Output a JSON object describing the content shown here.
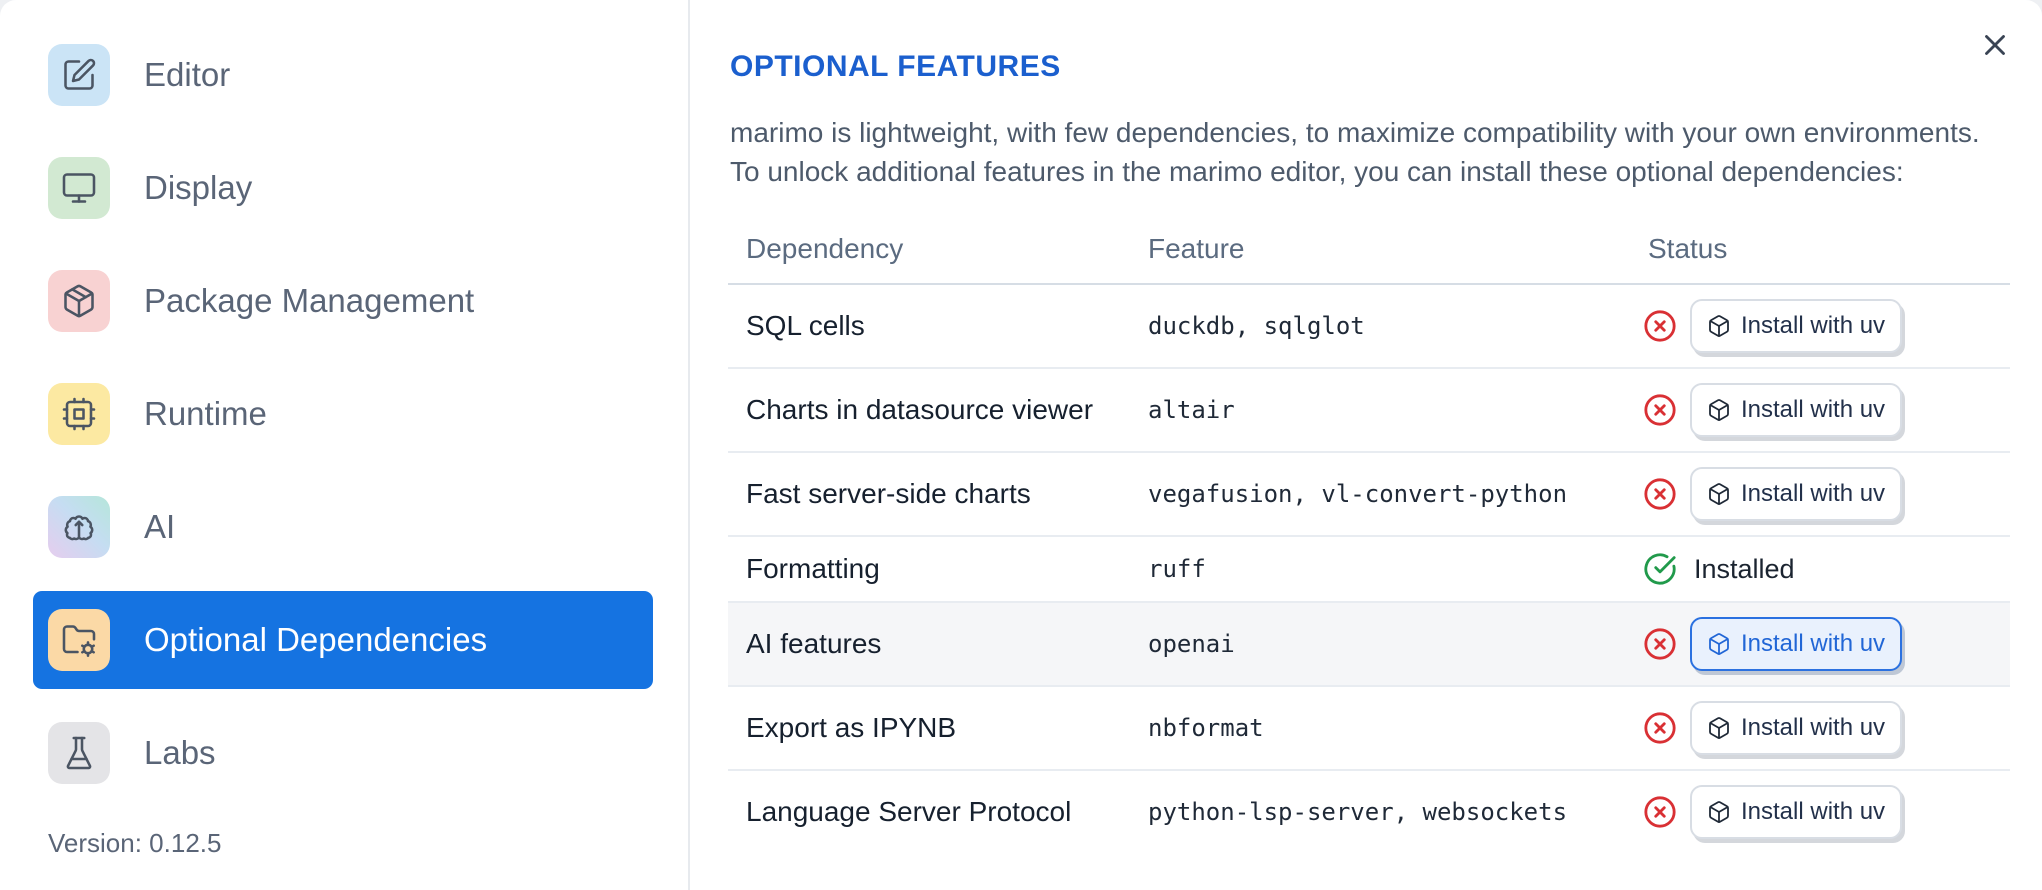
{
  "sidebar": {
    "items": [
      {
        "id": "editor",
        "label": "Editor",
        "icon": "square-pen",
        "icon_bg": "#cbe4f6",
        "selected": false
      },
      {
        "id": "display",
        "label": "Display",
        "icon": "monitor",
        "icon_bg": "#d2e9d2",
        "selected": false
      },
      {
        "id": "package-management",
        "label": "Package Management",
        "icon": "package",
        "icon_bg": "#f8d2d2",
        "selected": false
      },
      {
        "id": "runtime",
        "label": "Runtime",
        "icon": "cpu",
        "icon_bg": "#fce9a2",
        "selected": false
      },
      {
        "id": "ai",
        "label": "AI",
        "icon": "brain",
        "icon_bg": "linear-gradient(45deg,#e6cdee 0%,#c5ddf2 55%,#b5e6da 100%)",
        "selected": false
      },
      {
        "id": "optional-dependencies",
        "label": "Optional Dependencies",
        "icon": "folder-cog",
        "icon_bg": "#fbd9a6",
        "selected": true
      },
      {
        "id": "labs",
        "label": "Labs",
        "icon": "flask",
        "icon_bg": "#e4e4e7",
        "selected": false
      }
    ],
    "version_label": "Version: 0.12.5"
  },
  "panel": {
    "title": "OPTIONAL FEATURES",
    "description_lines": [
      "marimo is lightweight, with few dependencies, to maximize compatibility with your own environments.",
      "To unlock additional features in the marimo editor, you can install these optional dependencies:"
    ],
    "table": {
      "headers": [
        "Dependency",
        "Feature",
        "Status"
      ],
      "install_button_label": "Install with uv",
      "installed_label": "Installed",
      "rows": [
        {
          "dependency": "SQL cells",
          "feature": "duckdb, sqlglot",
          "installed": false,
          "highlighted": false
        },
        {
          "dependency": "Charts in datasource viewer",
          "feature": "altair",
          "installed": false,
          "highlighted": false
        },
        {
          "dependency": "Fast server-side charts",
          "feature": "vegafusion, vl-convert-python",
          "installed": false,
          "highlighted": false
        },
        {
          "dependency": "Formatting",
          "feature": "ruff",
          "installed": true,
          "highlighted": false
        },
        {
          "dependency": "AI features",
          "feature": "openai",
          "installed": false,
          "highlighted": true
        },
        {
          "dependency": "Export as IPYNB",
          "feature": "nbformat",
          "installed": false,
          "highlighted": false
        },
        {
          "dependency": "Language Server Protocol",
          "feature": "python-lsp-server, websockets",
          "installed": false,
          "highlighted": false
        }
      ]
    }
  },
  "colors": {
    "accent_blue": "#1573e1",
    "title_blue": "#1b5fce",
    "error_red": "#d93034",
    "success_green": "#219a4b"
  }
}
